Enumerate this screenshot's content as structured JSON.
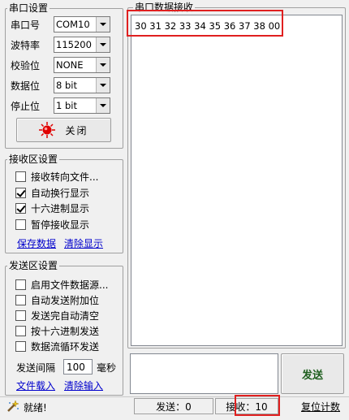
{
  "serial_settings": {
    "title": "串口设置",
    "port": {
      "label": "串口号",
      "value": "COM10"
    },
    "baud": {
      "label": "波特率",
      "value": "115200"
    },
    "parity": {
      "label": "校验位",
      "value": "NONE"
    },
    "data_bits": {
      "label": "数据位",
      "value": "8 bit"
    },
    "stop_bits": {
      "label": "停止位",
      "value": "1 bit"
    },
    "close_button": "关闭",
    "indicator_color": "#e00000"
  },
  "receive_settings": {
    "title": "接收区设置",
    "options": [
      {
        "label": "接收转向文件...",
        "checked": false
      },
      {
        "label": "自动换行显示",
        "checked": true
      },
      {
        "label": "十六进制显示",
        "checked": true
      },
      {
        "label": "暂停接收显示",
        "checked": false
      }
    ],
    "save_link": "保存数据",
    "clear_link": "清除显示"
  },
  "send_settings": {
    "title": "发送区设置",
    "options": [
      {
        "label": "启用文件数据源...",
        "checked": false
      },
      {
        "label": "自动发送附加位",
        "checked": false
      },
      {
        "label": "发送完自动清空",
        "checked": false
      },
      {
        "label": "按十六进制发送",
        "checked": false
      },
      {
        "label": "数据流循环发送",
        "checked": false
      }
    ],
    "interval_label": "发送间隔",
    "interval_value": "100",
    "interval_unit": "毫秒",
    "load_file_link": "文件载入",
    "clear_input_link": "清除输入"
  },
  "receive_area": {
    "title": "串口数据接收",
    "content": "30 31 32 33 34 35 36 37 38 00"
  },
  "send_area": {
    "content": "",
    "send_button": "发送"
  },
  "status_bar": {
    "ready_text": "就绪!",
    "sent_text": "发送：0",
    "received_text": "接收：10",
    "reset_button": "复位计数"
  },
  "highlight_color": "#e02020"
}
